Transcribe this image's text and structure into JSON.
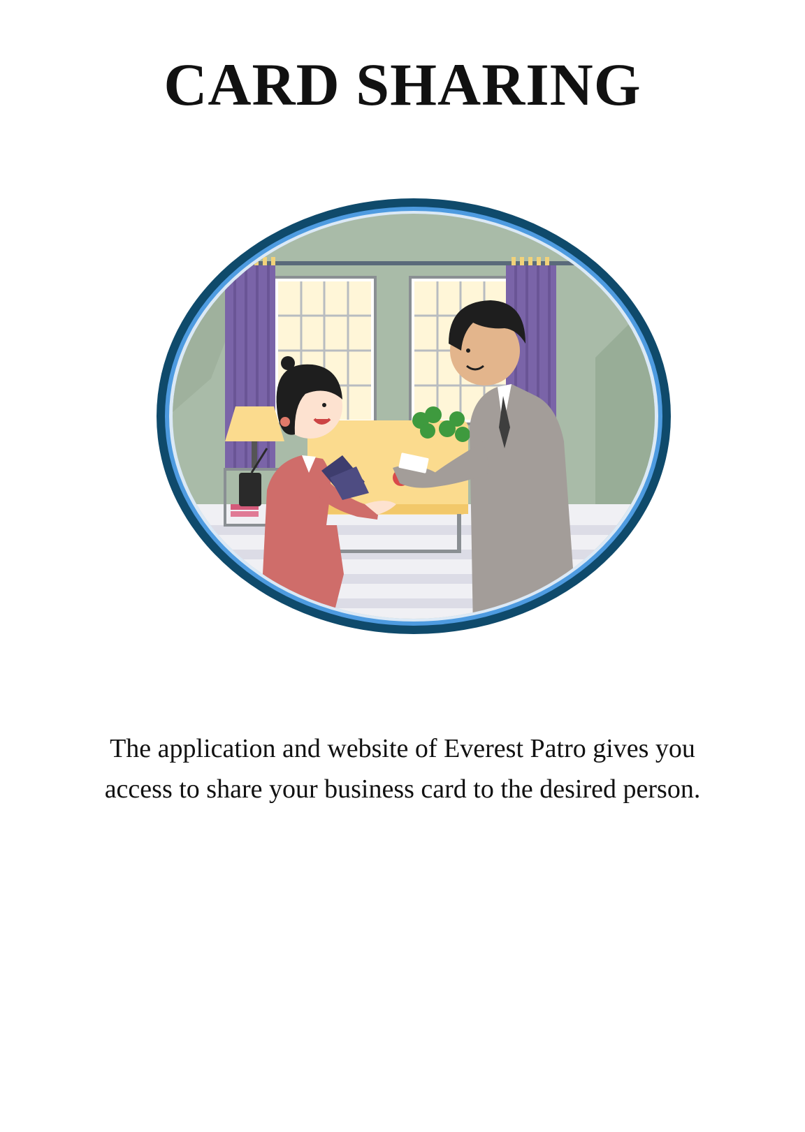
{
  "page": {
    "title": "CARD SHARING",
    "description_lines": [
      "The application and website of Everest Patro gives you",
      "access to share your business card to the desired person."
    ]
  },
  "illustration": {
    "subject": "business-card-exchange",
    "colors": {
      "frame_outer": "#0f4a6b",
      "frame_inner": "#4e9be0",
      "wall": "#a9bba8",
      "curtain": "#7a64a8",
      "desk": "#fbdb8e",
      "woman_jacket": "#cf6d6a",
      "man_suit": "#a39d99"
    }
  }
}
